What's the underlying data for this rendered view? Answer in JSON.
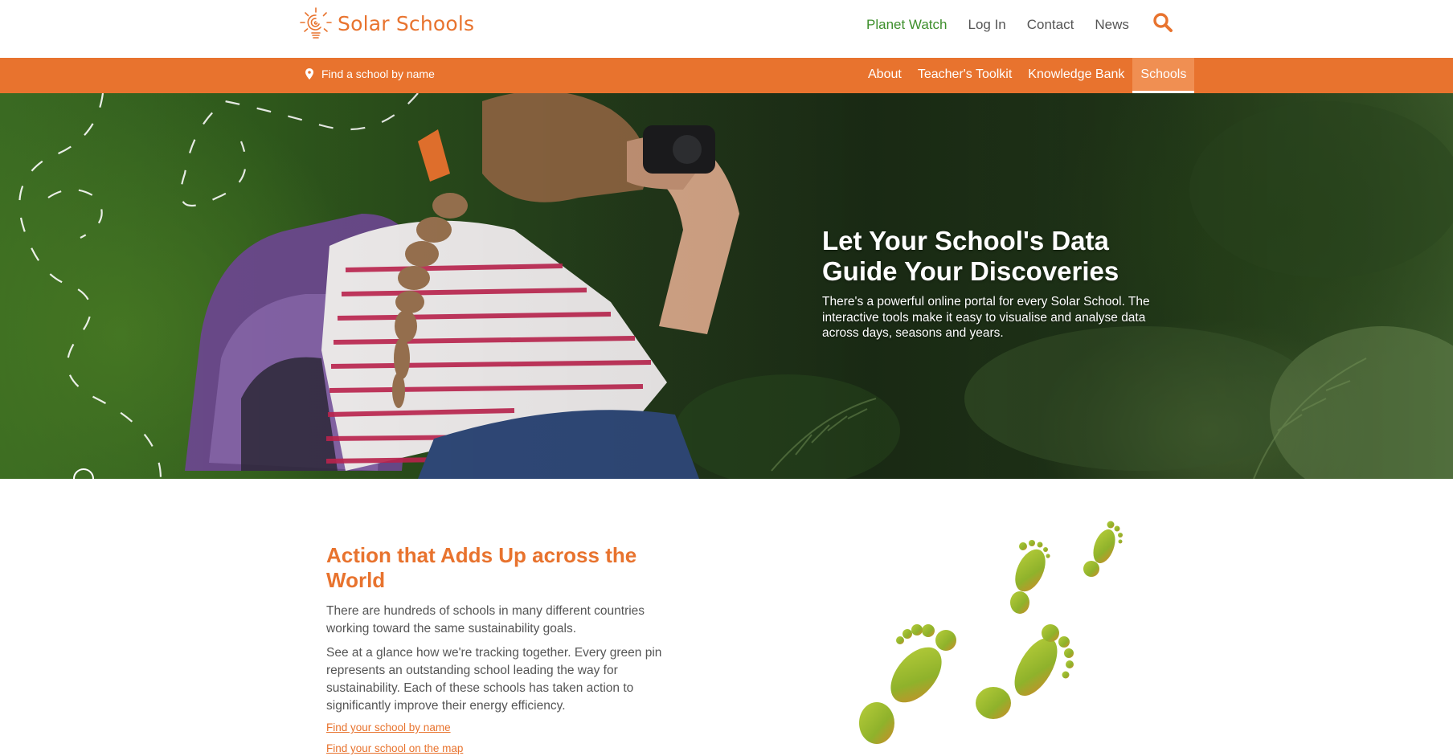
{
  "header": {
    "brand": "Solar Schools",
    "nav": [
      {
        "label": "Planet Watch"
      },
      {
        "label": "Log In"
      },
      {
        "label": "Contact"
      },
      {
        "label": "News"
      }
    ]
  },
  "subbar": {
    "find_label": "Find a school by name",
    "nav": [
      {
        "label": "About"
      },
      {
        "label": "Teacher's Toolkit"
      },
      {
        "label": "Knowledge Bank"
      },
      {
        "label": "Schools"
      }
    ],
    "active": "Schools"
  },
  "hero": {
    "title": "Let Your School's Data Guide Your Discoveries",
    "text": "There's a powerful online portal for every Solar School. The interactive tools make it easy to visualise and analyse data across days, seasons and years."
  },
  "section": {
    "title": "Action that Adds Up across the World",
    "p1": "There are hundreds of schools in many different countries working toward the same sustainability goals.",
    "p2": "See at a glance how we're tracking together. Every green pin represents an outstanding school leading the way for sustainability. Each of these schools has taken action to significantly improve their energy efficiency.",
    "link_name": "Find your school by name",
    "link_map": "Find your school on the map"
  },
  "colors": {
    "brand_orange": "#e8732e",
    "planet_watch_green": "#3d8f2b",
    "active_tab": "#f08f52"
  },
  "icons": [
    "sun-bulb-logo-icon",
    "search-icon",
    "map-pin-icon",
    "footprints-illustration"
  ]
}
